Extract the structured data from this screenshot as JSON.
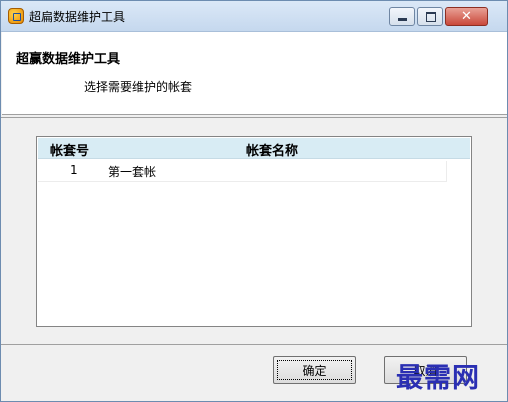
{
  "window": {
    "title": "超扁数据维护工具",
    "controls": {
      "minimize": "",
      "maximize": "",
      "close": "✕"
    }
  },
  "header": {
    "title": "超赢数据维护工具",
    "subtitle": "选择需要维护的帐套"
  },
  "list": {
    "columns": [
      "帐套号",
      "帐套名称"
    ],
    "rows": [
      {
        "no": "1",
        "name": "第一套帐"
      }
    ]
  },
  "buttons": {
    "ok": "确定",
    "cancel": "取消"
  },
  "watermark": "最需网",
  "colors": {
    "accent": "#d8ecf4",
    "close": "#c9483a",
    "watermark": "#2a2fb3"
  }
}
